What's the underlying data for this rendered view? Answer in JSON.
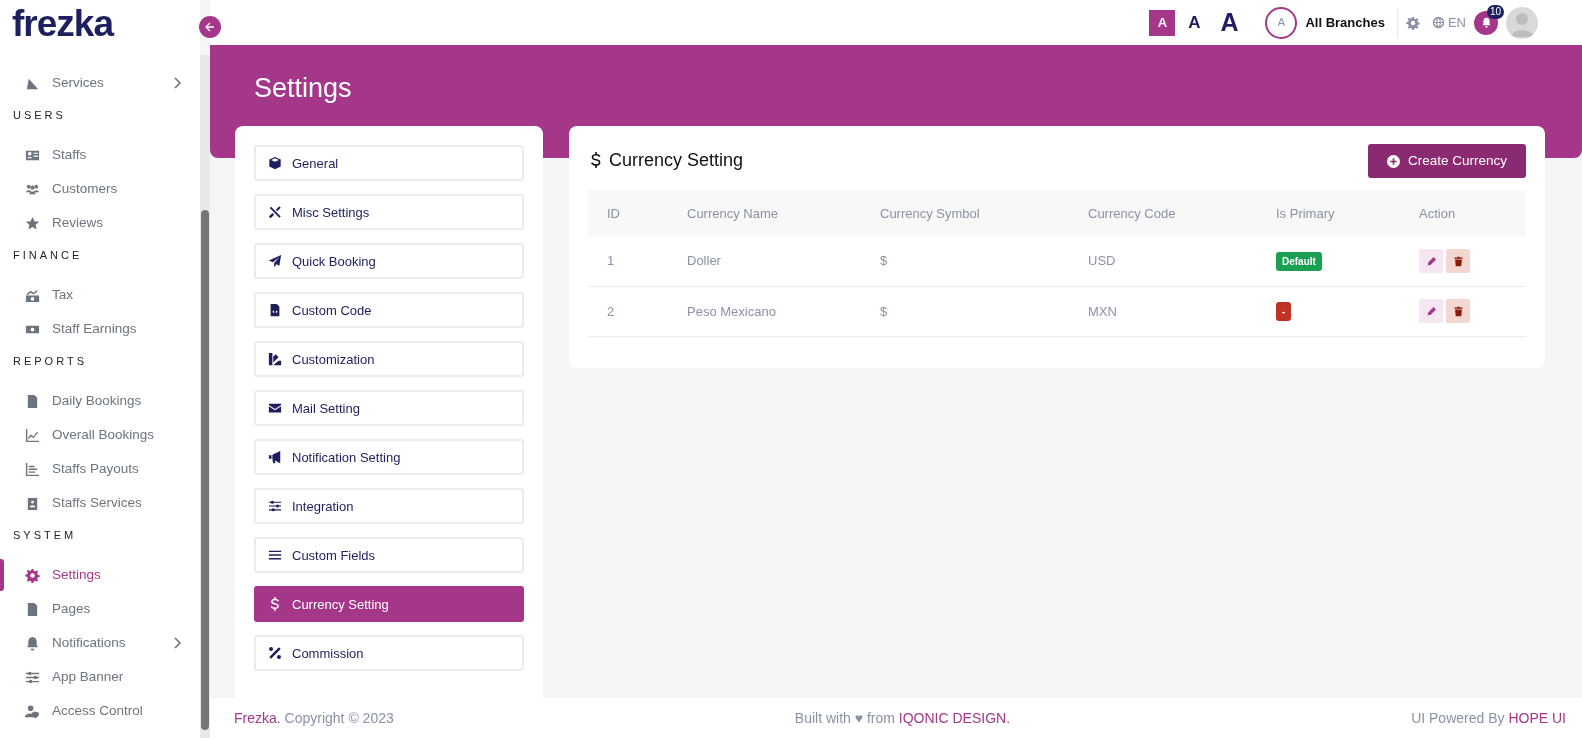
{
  "logo": {
    "text": "frezka"
  },
  "sidebar": {
    "items": [
      {
        "label": "Services",
        "has_submenu": true,
        "selected": false
      }
    ],
    "sections": [
      {
        "title": "USERS",
        "items": [
          {
            "label": "Staffs",
            "has_submenu": false,
            "selected": false
          },
          {
            "label": "Customers",
            "has_submenu": false,
            "selected": false
          },
          {
            "label": "Reviews",
            "has_submenu": false,
            "selected": false
          }
        ]
      },
      {
        "title": "FINANCE",
        "items": [
          {
            "label": "Tax",
            "has_submenu": false,
            "selected": false
          },
          {
            "label": "Staff Earnings",
            "has_submenu": false,
            "selected": false
          }
        ]
      },
      {
        "title": "REPORTS",
        "items": [
          {
            "label": "Daily Bookings",
            "has_submenu": false,
            "selected": false
          },
          {
            "label": "Overall Bookings",
            "has_submenu": false,
            "selected": false
          },
          {
            "label": "Staffs Payouts",
            "has_submenu": false,
            "selected": false
          },
          {
            "label": "Staffs Services",
            "has_submenu": false,
            "selected": false
          }
        ]
      },
      {
        "title": "SYSTEM",
        "items": [
          {
            "label": "Settings",
            "has_submenu": false,
            "selected": true
          },
          {
            "label": "Pages",
            "has_submenu": false,
            "selected": false
          },
          {
            "label": "Notifications",
            "has_submenu": true,
            "selected": false
          },
          {
            "label": "App Banner",
            "has_submenu": false,
            "selected": false
          },
          {
            "label": "Access Control",
            "has_submenu": false,
            "selected": false
          }
        ]
      }
    ]
  },
  "header": {
    "font_sizes": [
      {
        "label": "A",
        "selected": true
      },
      {
        "label": "A",
        "selected": false
      },
      {
        "label": "A",
        "selected": false
      }
    ],
    "branch": {
      "initial": "A",
      "label": "All Branches"
    },
    "language": "EN",
    "notification_count": "10"
  },
  "page_title": "Settings",
  "settings_menu": [
    {
      "label": "General",
      "selected": false
    },
    {
      "label": "Misc Settings",
      "selected": false
    },
    {
      "label": "Quick Booking",
      "selected": false
    },
    {
      "label": "Custom Code",
      "selected": false
    },
    {
      "label": "Customization",
      "selected": false
    },
    {
      "label": "Mail Setting",
      "selected": false
    },
    {
      "label": "Notification Setting",
      "selected": false
    },
    {
      "label": "Integration",
      "selected": false
    },
    {
      "label": "Custom Fields",
      "selected": false
    },
    {
      "label": "Currency Setting",
      "selected": true
    },
    {
      "label": "Commission",
      "selected": false
    }
  ],
  "currency_card": {
    "title": "Currency Setting",
    "create_button": "Create Currency",
    "table": {
      "columns": [
        "ID",
        "Currency Name",
        "Currency Symbol",
        "Currency Code",
        "Is Primary",
        "Action"
      ],
      "rows": [
        {
          "id": "1",
          "name": "Doller",
          "symbol": "$",
          "code": "USD",
          "primary_badge": {
            "label": "Default",
            "primary": true
          }
        },
        {
          "id": "2",
          "name": "Peso Mexicano",
          "symbol": "$",
          "code": "MXN",
          "primary_badge": {
            "label": "-",
            "primary": false
          }
        }
      ]
    }
  },
  "footer": {
    "brand": "Frezka.",
    "copyright": " Copyright © 2023",
    "built_with": "Built with ♥ from ",
    "company": "IQONIC DESIGN.",
    "powered_by": "UI Powered By ",
    "ui_kit": "HOPE UI"
  }
}
